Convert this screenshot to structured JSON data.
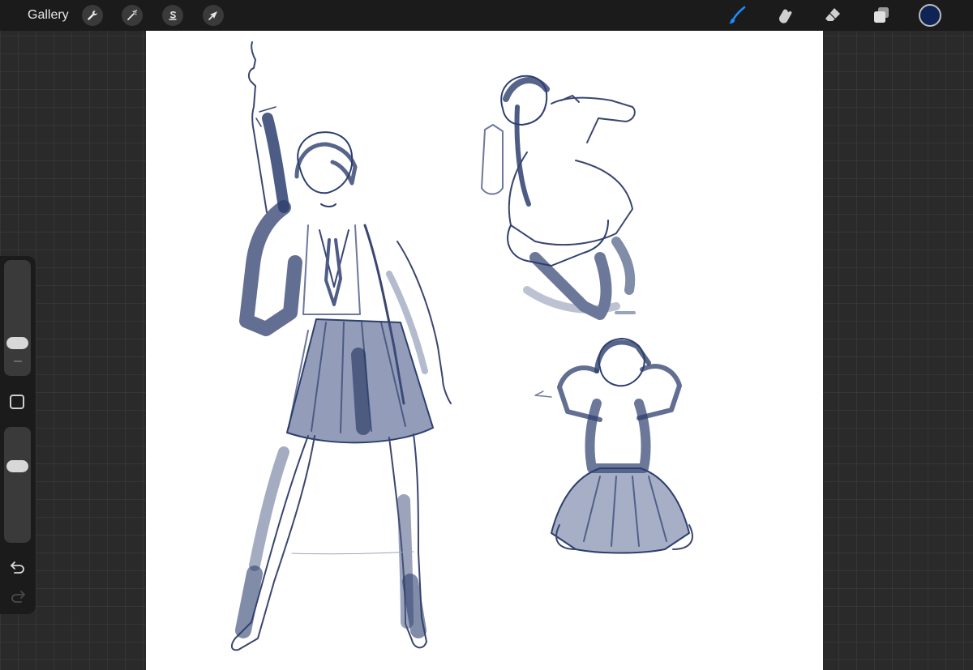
{
  "toolbar": {
    "gallery_label": "Gallery",
    "left_tools": [
      {
        "name": "actions",
        "icon": "wrench-icon"
      },
      {
        "name": "adjustments",
        "icon": "magic-wand-icon"
      },
      {
        "name": "selection",
        "icon": "selection-s-icon"
      },
      {
        "name": "transform",
        "icon": "arrow-cursor-icon"
      }
    ],
    "right_tools": [
      {
        "name": "brush",
        "icon": "brush-icon",
        "active": true
      },
      {
        "name": "smudge",
        "icon": "smudge-finger-icon",
        "active": false
      },
      {
        "name": "eraser",
        "icon": "eraser-icon",
        "active": false
      },
      {
        "name": "layers",
        "icon": "layers-icon",
        "active": false
      }
    ],
    "current_color": "#0f2454",
    "active_tool_color": "#1a8cff"
  },
  "sidebar": {
    "brush_size_level": 0.32,
    "opacity_level": 0.65,
    "modify_button_icon": "square-icon",
    "undo_icon": "undo-arrow-icon",
    "redo_icon": "redo-arrow-icon"
  },
  "canvas": {
    "background": "#ffffff",
    "ink_color": "#2d3f6e",
    "content": [
      "standing-figure-sketch",
      "crouching-figure-sketch",
      "kneeling-figure-sketch"
    ]
  }
}
